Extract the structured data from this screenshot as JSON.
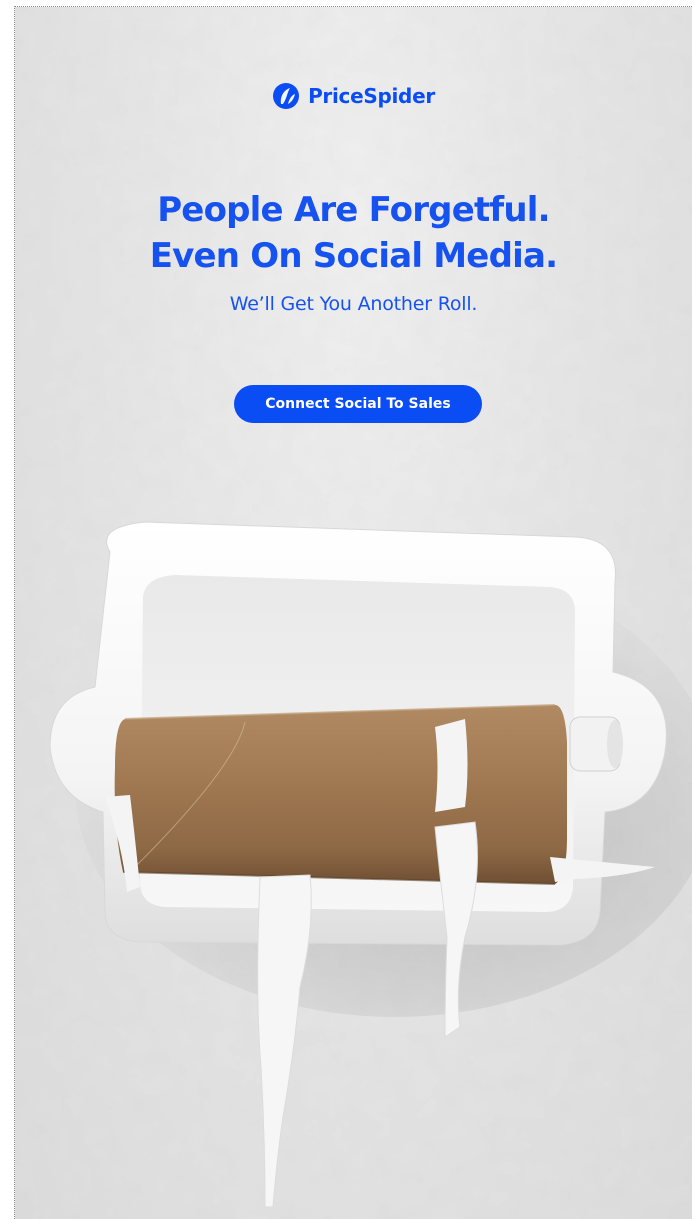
{
  "brand": {
    "name": "PriceSpider",
    "accent_color": "#0a4df5",
    "logo_icon": "pricespider-mark-icon"
  },
  "hero": {
    "headline_line1": "People Are Forgetful.",
    "headline_line2": "Even On Social Media.",
    "subheadline": "We’ll Get You Another Roll.",
    "cta_label": "Connect Social To Sales"
  },
  "image": {
    "subject": "empty-toilet-paper-roll-on-holder"
  }
}
